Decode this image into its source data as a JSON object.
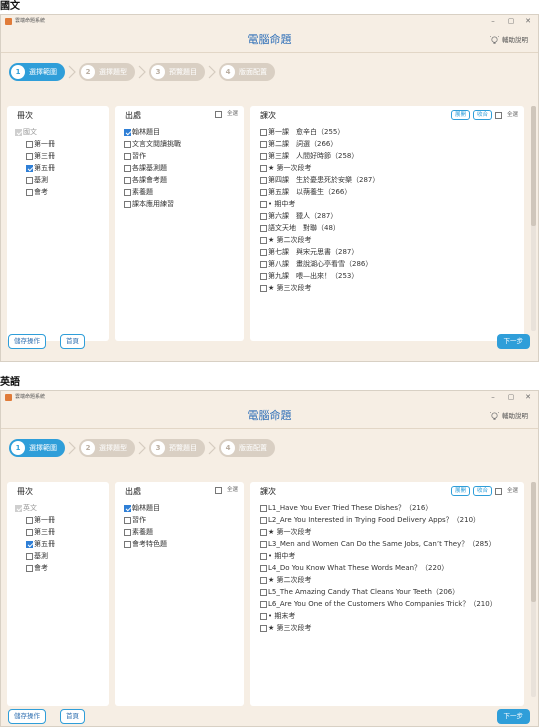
{
  "windows": [
    {
      "section_label": "國文",
      "app_name": "雲端命題系統",
      "title": "電腦命題",
      "help_label": "輔助說明",
      "window_controls": [
        "–",
        "▢",
        "✕"
      ],
      "steps": [
        {
          "num": "1",
          "label": "選擇範圍"
        },
        {
          "num": "2",
          "label": "選擇題型"
        },
        {
          "num": "3",
          "label": "預覽題目"
        },
        {
          "num": "4",
          "label": "版面配置"
        }
      ],
      "volumes": {
        "head": "冊次",
        "root": "國文",
        "items": [
          {
            "label": "第一冊",
            "checked": false
          },
          {
            "label": "第三冊",
            "checked": false
          },
          {
            "label": "第五冊",
            "checked": true
          },
          {
            "label": "基測",
            "checked": false
          },
          {
            "label": "會考",
            "checked": false
          }
        ]
      },
      "sources": {
        "head": "出處",
        "all_label": "全選",
        "items": [
          {
            "label": "翰林題目",
            "checked": true
          },
          {
            "label": "文言文閱讀挑戰",
            "checked": false
          },
          {
            "label": "習作",
            "checked": false
          },
          {
            "label": "各課基測題",
            "checked": false
          },
          {
            "label": "各課會考題",
            "checked": false
          },
          {
            "label": "素養題",
            "checked": false
          },
          {
            "label": "課本應用練習",
            "checked": false
          }
        ]
      },
      "lessons": {
        "head": "課次",
        "expand_label": "展開",
        "collapse_label": "收合",
        "all_label": "全選",
        "items": [
          "第一課　愈辛白（255）",
          "第二課　詞選（266）",
          "第三課　人間好時節（258）",
          "★ 第一次段考",
          "第四課　生於憂患死於安樂（287）",
          "第五課　以蒴養生（266）",
          "• 期中考",
          "第六課　獵人（287）",
          "語文天地　對聯（48）",
          "★ 第二次段考",
          "第七課　與宋元思書（287）",
          "第八課　畫說湖心亭看雪（286）",
          "第九課　喂—出來！（253）",
          "★ 第三次段考"
        ]
      },
      "save_label": "儲存操作",
      "home_label": "首頁",
      "next_label": "下一步"
    },
    {
      "section_label": "英語",
      "app_name": "雲端命題系統",
      "title": "電腦命題",
      "help_label": "輔助說明",
      "window_controls": [
        "–",
        "▢",
        "✕"
      ],
      "steps": [
        {
          "num": "1",
          "label": "選擇範圍"
        },
        {
          "num": "2",
          "label": "選擇題型"
        },
        {
          "num": "3",
          "label": "預覽題目"
        },
        {
          "num": "4",
          "label": "版面配置"
        }
      ],
      "volumes": {
        "head": "冊次",
        "root": "英文",
        "items": [
          {
            "label": "第一冊",
            "checked": false
          },
          {
            "label": "第三冊",
            "checked": false
          },
          {
            "label": "第五冊",
            "checked": true
          },
          {
            "label": "基測",
            "checked": false
          },
          {
            "label": "會考",
            "checked": false
          }
        ]
      },
      "sources": {
        "head": "出處",
        "all_label": "全選",
        "items": [
          {
            "label": "翰林題目",
            "checked": true
          },
          {
            "label": "習作",
            "checked": false
          },
          {
            "label": "素養題",
            "checked": false
          },
          {
            "label": "會考特色題",
            "checked": false
          }
        ]
      },
      "lessons": {
        "head": "課次",
        "expand_label": "展開",
        "collapse_label": "收合",
        "all_label": "全選",
        "items": [
          "L1_Have You Ever Tried These Dishes？（216）",
          "L2_Are You Interested in Trying Food Delivery Apps？（210）",
          "★ 第一次段考",
          "L3_Men and Women Can Do the Same Jobs, Can’t They？（285）",
          "• 期中考",
          "L4_Do You Know What These Words Mean？（220）",
          "★ 第二次段考",
          "L5_The Amazing Candy That Cleans Your Teeth（206）",
          "L6_Are You One of the Customers Who Companies Trick？（210）",
          "• 期末考",
          "★ 第三次段考"
        ]
      },
      "save_label": "儲存操作",
      "home_label": "首頁",
      "next_label": "下一步"
    }
  ]
}
